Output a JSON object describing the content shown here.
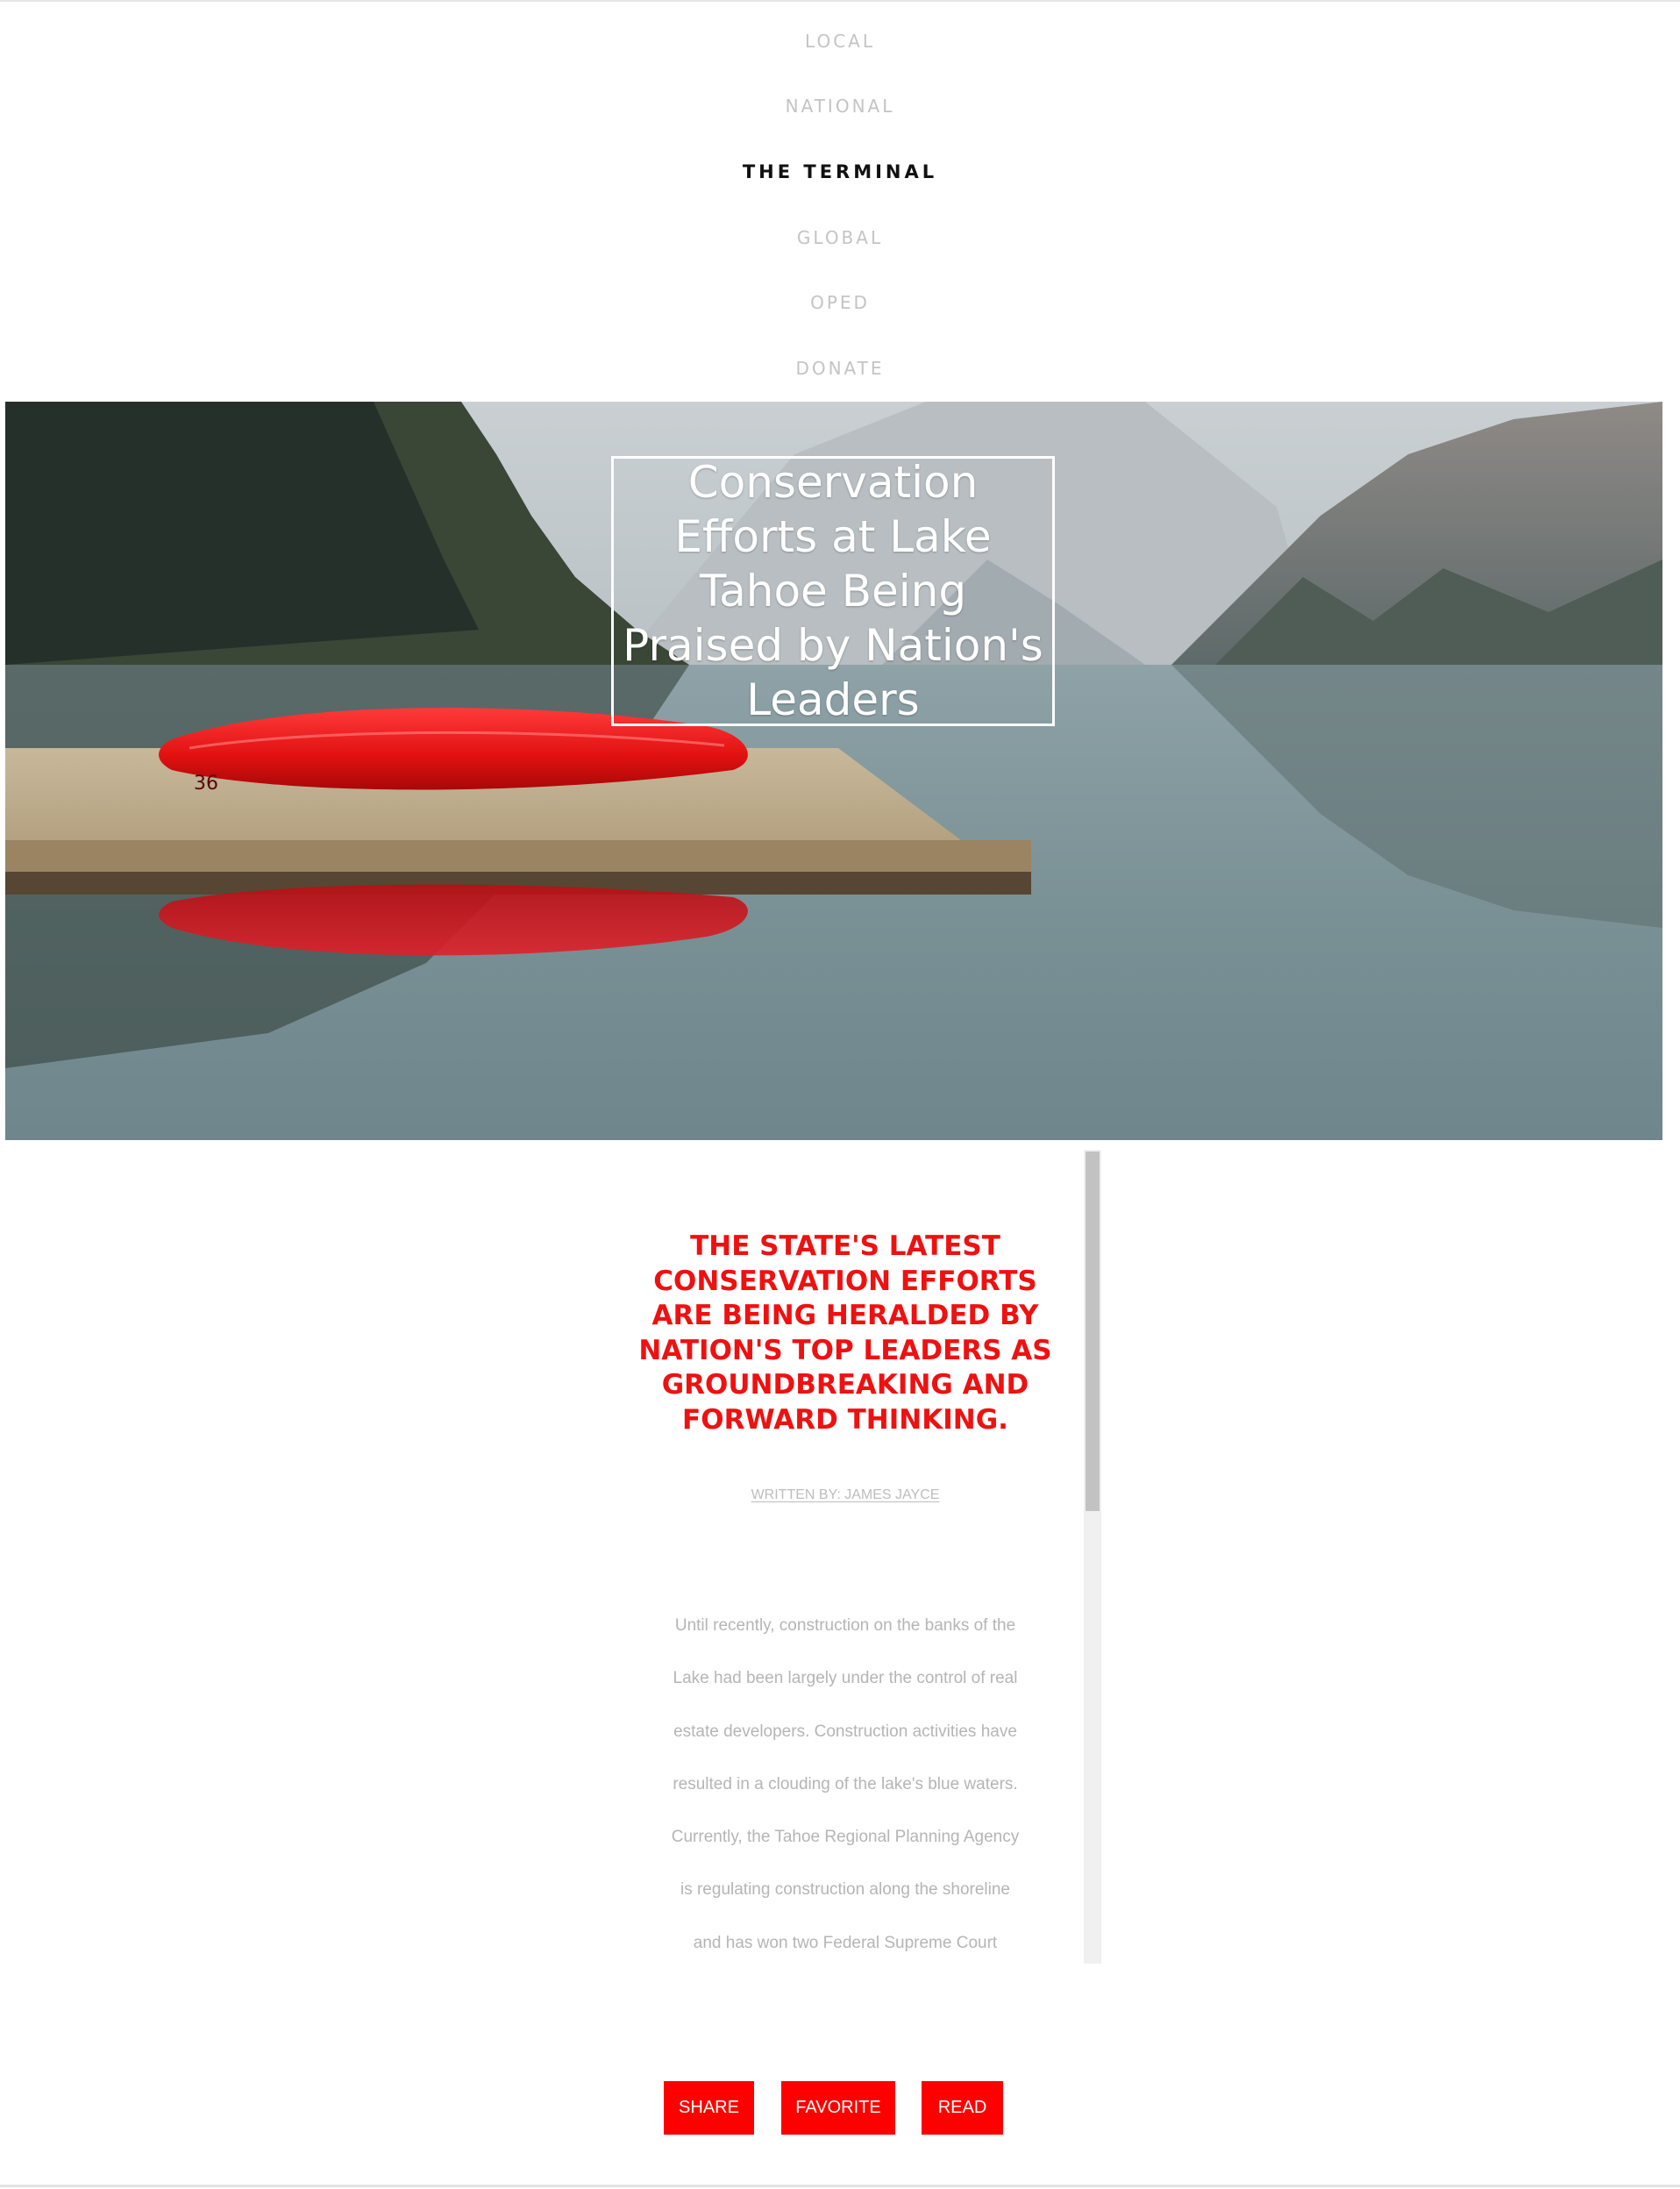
{
  "nav": {
    "items": [
      {
        "label": "LOCAL",
        "active": false
      },
      {
        "label": "NATIONAL",
        "active": false
      },
      {
        "label": "THE TERMINAL",
        "active": true
      },
      {
        "label": "GLOBAL",
        "active": false
      },
      {
        "label": "OPED",
        "active": false
      },
      {
        "label": "DONATE",
        "active": false
      }
    ]
  },
  "hero": {
    "title": "Conservation Efforts at Lake Tahoe Being Praised by Nation's Leaders",
    "canoe_number": "36"
  },
  "article": {
    "subheading": "THE STATE'S LATEST CONSERVATION EFFORTS ARE BEING HERALDED BY NATION'S TOP LEADERS AS GROUNDBREAKING AND FORWARD THINKING.",
    "byline": "WRITTEN BY: JAMES JAYCE",
    "body_lines": [
      "Until recently, construction on the banks of the",
      "Lake had been largely under the control of real",
      "estate developers. Construction activities have",
      "resulted in a clouding of the lake's blue waters.",
      "Currently, the Tahoe Regional Planning Agency",
      "is regulating construction along the shoreline",
      "and has won two Federal Supreme Court"
    ]
  },
  "actions": {
    "share_label": "SHARE",
    "favorite_label": "FAVORITE",
    "read_label": "READ"
  },
  "colors": {
    "accent": "#ff0000",
    "subheading": "#ee1111",
    "nav_inactive": "#c4c4c4",
    "nav_active": "#111111",
    "body_text": "#b5b5b5"
  }
}
